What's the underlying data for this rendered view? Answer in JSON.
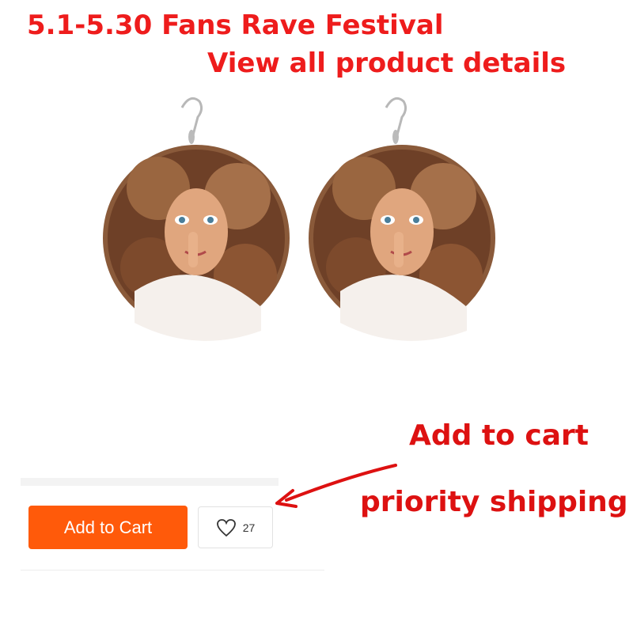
{
  "promo": {
    "line1": "5.1-5.30 Fans Rave Festival",
    "line2": "View all product details"
  },
  "product": {
    "images": [
      "earring-left",
      "earring-right"
    ]
  },
  "actions": {
    "add_to_cart_label": "Add to Cart",
    "wishlist_count": "27",
    "accent_color": "#ff5a0a"
  },
  "annotations": {
    "add_to_cart": "Add to cart",
    "priority_shipping": "priority shipping",
    "color": "#dd1111"
  }
}
